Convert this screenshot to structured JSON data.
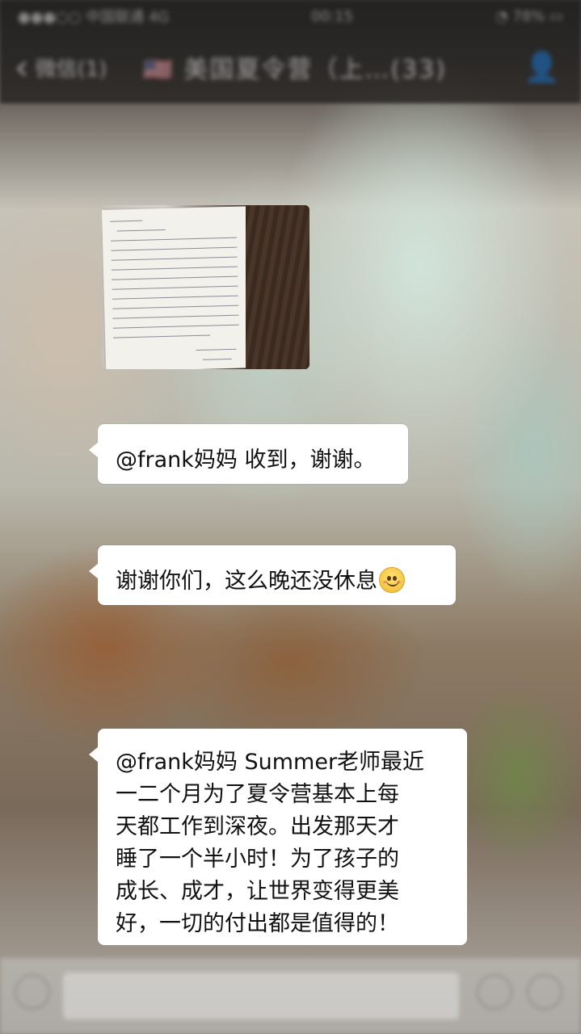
{
  "status_bar": {
    "carrier": "●●●○○ 中国联通 4G",
    "time": "00:15",
    "battery": "◔ 78% ▭"
  },
  "nav": {
    "back_label": "微信(1)",
    "title": "🇺🇸 美国夏令营（上…(33)",
    "menu_icon": "person-icon"
  },
  "messages": [
    {
      "type": "image",
      "description_icon": "handwritten-letter-photo"
    },
    {
      "type": "text",
      "text": "@frank妈妈 收到，谢谢。"
    },
    {
      "type": "text",
      "text": "谢谢你们，这么晚还没休息",
      "emoji": "smile-emoji"
    },
    {
      "type": "text",
      "lines": [
        "@frank妈妈 Summer老师最近",
        "一二个月为了夏令营基本上每",
        "天都工作到深夜。出发那天才",
        "睡了一个半小时！为了孩子的",
        "成长、成才，让世界变得更美",
        "好，一切的付出都是值得的！"
      ]
    }
  ],
  "composer": {
    "voice_icon": "voice-icon",
    "emoji_icon": "emoji-icon",
    "plus_icon": "plus-icon"
  }
}
